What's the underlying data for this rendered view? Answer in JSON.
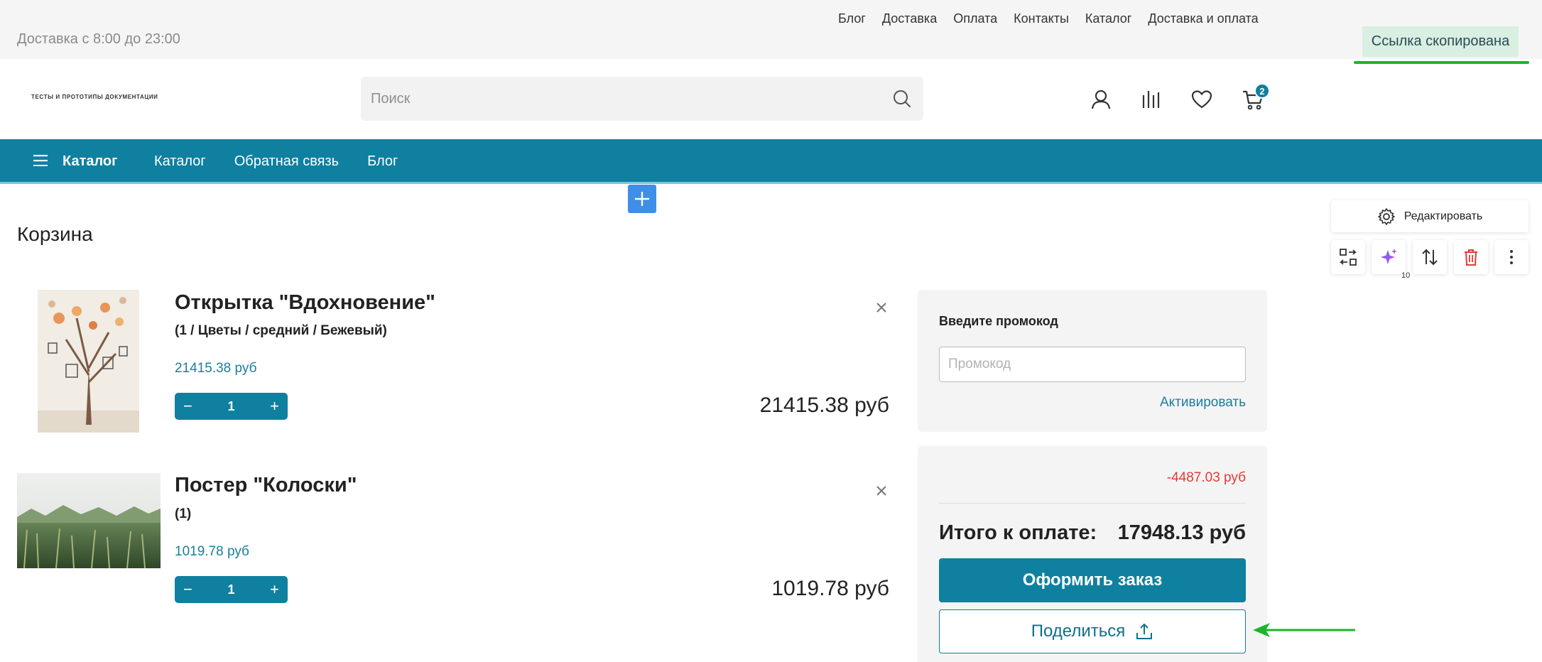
{
  "topbar": {
    "delivery_hours": "Доставка с 8:00 до 23:00",
    "links": [
      "Блог",
      "Доставка",
      "Оплата",
      "Контакты",
      "Каталог",
      "Доставка и оплата"
    ]
  },
  "toast": {
    "text": "Ссылка скопирована",
    "color": "#1bb52c"
  },
  "header": {
    "logo_text": "ТЕСТЫ И ПРОТОТИПЫ ДОКУМЕНТАЦИИ",
    "search_placeholder": "Поиск",
    "cart_count": "2",
    "icons": [
      "user-icon",
      "compare-icon",
      "heart-icon",
      "cart-icon"
    ]
  },
  "nav": {
    "catalog_label": "Каталог",
    "links": [
      "Каталог",
      "Обратная связь",
      "Блог"
    ],
    "color": "#0f809f"
  },
  "editor": {
    "edit_label": "Редактировать",
    "ai_count": "10",
    "tools": [
      "swap-icon",
      "sparkle-icon",
      "sort-icon",
      "trash-icon",
      "more-icon"
    ]
  },
  "page": {
    "title": "Корзина"
  },
  "cart": {
    "items": [
      {
        "title": "Открытка \"Вдохновение\"",
        "variant": "(1 / Цветы / средний / Бежевый)",
        "unit_price": "21415.38 руб",
        "quantity": "1",
        "total": "21415.38 руб"
      },
      {
        "title": "Постер \"Колоски\"",
        "variant": "(1)",
        "unit_price": "1019.78 руб",
        "quantity": "1",
        "total": "1019.78 руб"
      }
    ]
  },
  "promo": {
    "label": "Введите промокод",
    "placeholder": "Промокод",
    "activate": "Активировать"
  },
  "summary": {
    "discount": "-4487.03 руб",
    "total_label": "Итого к оплате:",
    "total_value": "17948.13 руб",
    "order_button": "Оформить заказ",
    "share_button": "Поделиться"
  }
}
